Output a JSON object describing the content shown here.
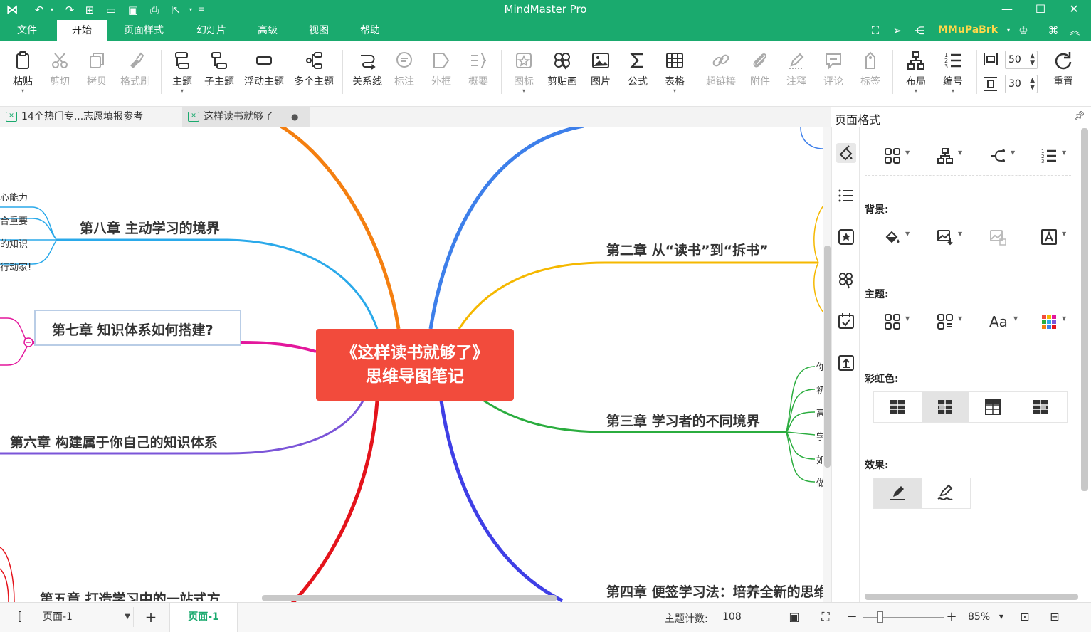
{
  "app": {
    "title": "MindMaster Pro"
  },
  "menu": {
    "items": [
      "文件",
      "开始",
      "页面样式",
      "幻灯片",
      "高级",
      "视图",
      "帮助"
    ],
    "active": "开始",
    "user": "MMuPaBrk"
  },
  "toolbar": {
    "paste": "粘贴",
    "cut": "剪切",
    "copy": "拷贝",
    "format_painter": "格式刷",
    "topic": "主题",
    "subtopic": "子主题",
    "floating_topic": "浮动主题",
    "multiple_topics": "多个主题",
    "relationship": "关系线",
    "callout": "标注",
    "boundary": "外框",
    "summary": "概要",
    "icon": "图标",
    "clipart": "剪贴画",
    "picture": "图片",
    "formula": "公式",
    "table": "表格",
    "hyperlink": "超链接",
    "attachment": "附件",
    "note": "注释",
    "comment": "评论",
    "tag": "标签",
    "layout": "布局",
    "numbering": "编号",
    "spacing_h": "50",
    "spacing_v": "30",
    "reset": "重置"
  },
  "tabs": {
    "doc1": "14个热门专...志愿填报参考",
    "doc2": "这样读书就够了"
  },
  "mindmap": {
    "central_line1": "《这样读书就够了》",
    "central_line2": "思维导图笔记",
    "ch2": "第二章 从“读书”到“拆书”",
    "ch3": "第三章 学习者的不同境界",
    "ch4": "第四章 便签学习法：培养全新的思维",
    "ch6": "第六章 构建属于你自己的知识体系",
    "ch7": "第七章 知识体系如何搭建?",
    "ch8": "第八章 主动学习的境界",
    "ch5": "第五章 打造学习中的一站式方",
    "ch8_sub": [
      "心能力",
      "合重要",
      "的知识",
      "行动家!"
    ],
    "ch3_sub": [
      "你",
      "初",
      "高",
      "学",
      "如",
      "做"
    ]
  },
  "panel": {
    "title": "页面格式",
    "background": "背景:",
    "theme": "主题:",
    "rainbow": "彩虹色:",
    "effect": "效果:"
  },
  "status": {
    "page_select": "页面-1",
    "page_tab": "页面-1",
    "topic_count_label": "主题计数:",
    "topic_count": "108",
    "zoom": "85%"
  },
  "colors": {
    "brand": "#1aaa6e",
    "central": "#f24b3c",
    "user": "#ffd84a"
  }
}
